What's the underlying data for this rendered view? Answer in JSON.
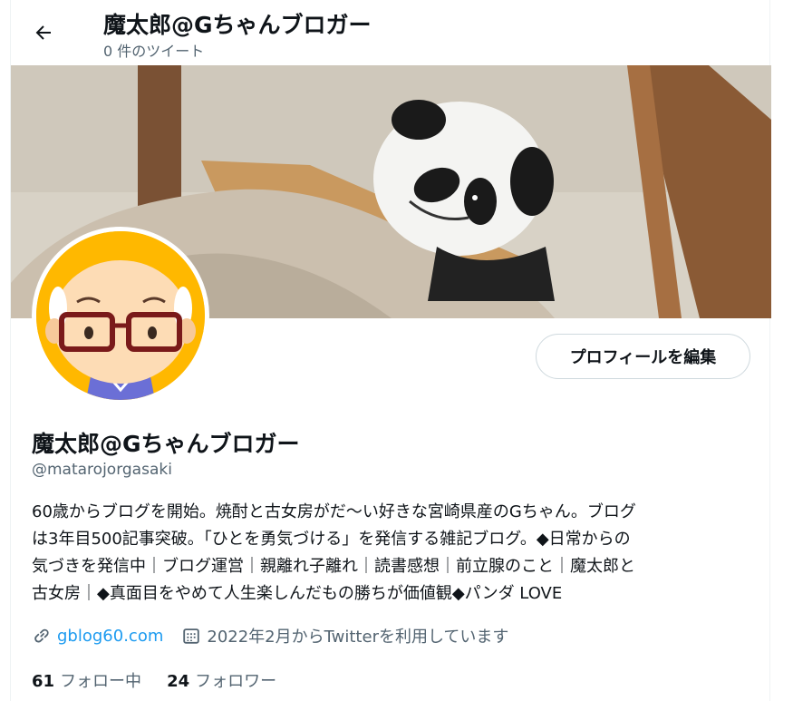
{
  "header": {
    "title": "魔太郎@Gちゃんブロガー",
    "tweet_count": "0 件のツイート"
  },
  "profile": {
    "name": "魔太郎@Gちゃんブロガー",
    "handle": "@matarojorgasaki",
    "edit_button": "プロフィールを編集",
    "bio": [
      "60歳からブログを開始。焼酎と古女房がだ〜い好きな宮崎県産のGちゃん。ブログ",
      "は3年目500記事突破。「ひとを勇気づける」を発信する雑記ブログ。◆日常からの",
      "気づきを発信中｜ブログ運営｜親離れ子離れ｜読書感想｜前立腺のこと｜魔太郎と",
      "古女房｜◆真面目をやめて人生楽しんだもの勝ちが価値観◆パンダ LOVE"
    ],
    "website": "gblog60.com",
    "joined": "2022年2月からTwitterを利用しています",
    "following_count": "61",
    "following_label": "フォロー中",
    "followers_count": "24",
    "followers_label": "フォロワー"
  },
  "colors": {
    "accent": "#1d9bf0",
    "secondary_text": "#536471",
    "avatar_bg": "#ffb800"
  },
  "icons": {
    "back": "arrow-left-icon",
    "link": "link-icon",
    "calendar": "calendar-icon"
  }
}
